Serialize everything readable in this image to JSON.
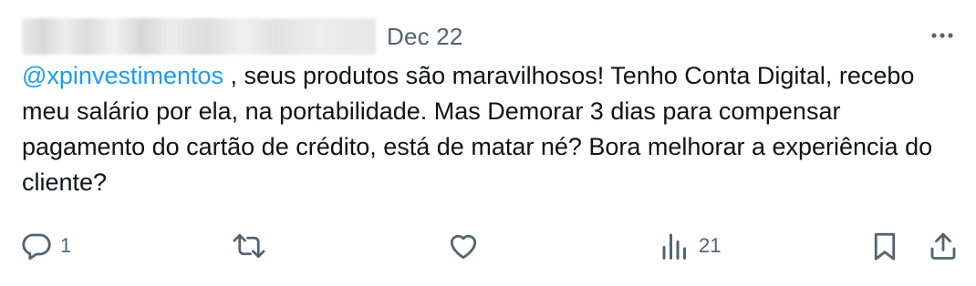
{
  "tweet": {
    "date": "Dec 22",
    "mention": "@xpinvestimentos",
    "text": " , seus produtos são maravilhosos! Tenho Conta Digital, recebo meu salário por ela, na portabilidade. Mas Demorar 3 dias para compensar pagamento do cartão de crédito, está de matar né? Bora melhorar a experiência do cliente?"
  },
  "actions": {
    "reply_count": "1",
    "retweet_count": "",
    "like_count": "",
    "views_count": "21"
  },
  "icons": {
    "more": "more-horizontal-icon",
    "reply": "reply-icon",
    "retweet": "retweet-icon",
    "like": "heart-icon",
    "views": "views-chart-icon",
    "bookmark": "bookmark-icon",
    "share": "share-icon"
  },
  "colors": {
    "text": "#0f1419",
    "secondary": "#536471",
    "accent": "#1d9bf0",
    "background": "#ffffff"
  }
}
